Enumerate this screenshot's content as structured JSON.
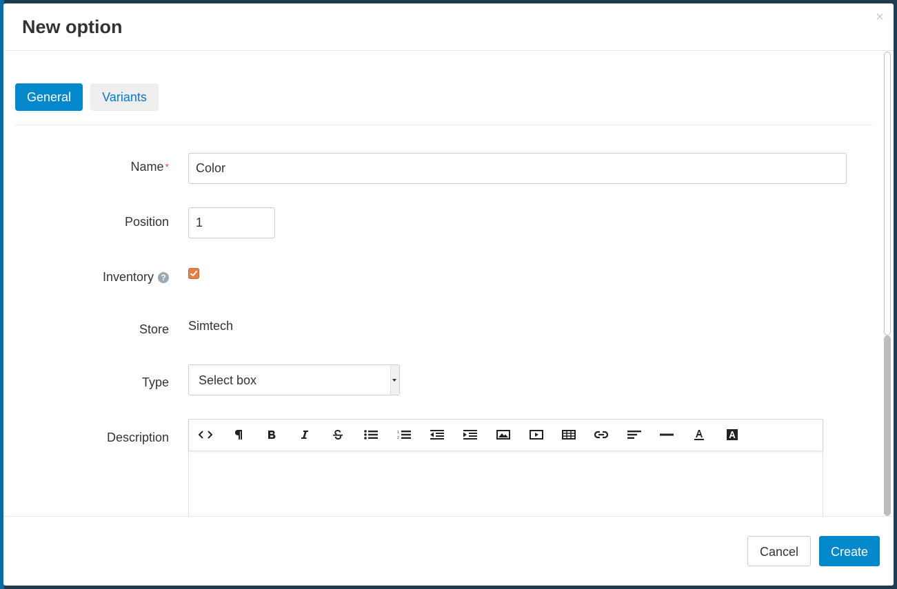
{
  "modal": {
    "title": "New option",
    "close_symbol": "×"
  },
  "tabs": [
    {
      "label": "General",
      "active": true
    },
    {
      "label": "Variants",
      "active": false
    }
  ],
  "form": {
    "name": {
      "label": "Name",
      "required_mark": "*",
      "value": "Color"
    },
    "position": {
      "label": "Position",
      "value": "1"
    },
    "inventory": {
      "label": "Inventory",
      "help_symbol": "?",
      "checked": true
    },
    "store": {
      "label": "Store",
      "value": "Simtech"
    },
    "type": {
      "label": "Type",
      "selected": "Select box"
    },
    "description": {
      "label": "Description",
      "toolbar": [
        "code-view-icon",
        "paragraph-icon",
        "bold-icon",
        "italic-icon",
        "strikethrough-icon",
        "unordered-list-icon",
        "ordered-list-icon",
        "outdent-icon",
        "indent-icon",
        "image-icon",
        "video-icon",
        "table-icon",
        "link-icon",
        "align-left-icon",
        "horizontal-rule-icon",
        "font-color-icon",
        "background-color-icon"
      ],
      "value": ""
    }
  },
  "footer": {
    "cancel_label": "Cancel",
    "create_label": "Create"
  },
  "colors": {
    "primary": "#0388cc",
    "checkbox": "#e97d46",
    "required": "#d9534f"
  }
}
